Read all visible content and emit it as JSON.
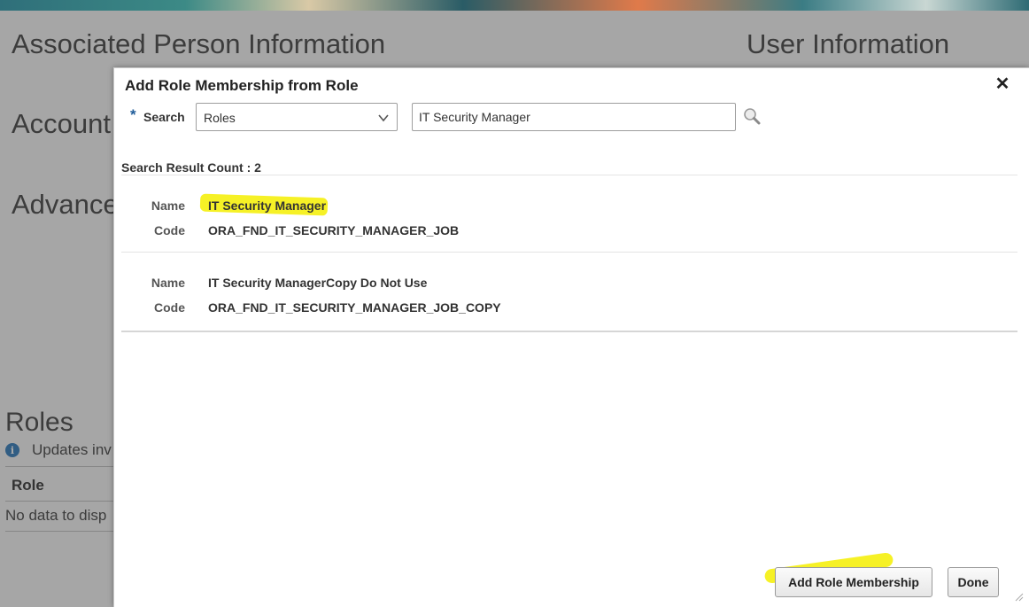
{
  "background": {
    "headings": {
      "associated_person": "Associated Person Information",
      "user_information": "User Information",
      "account": "Account",
      "advanced": "Advance"
    },
    "roles": {
      "title": "Roles",
      "info_text": "Updates inv",
      "column_header": "Role",
      "empty_text": "No data to disp"
    }
  },
  "dialog": {
    "title": "Add Role Membership from Role",
    "close_icon": "close-icon",
    "search": {
      "required_marker": "*",
      "label": "Search",
      "type_value": "Roles",
      "query_value": "IT Security Manager",
      "search_icon": "magnifier-icon"
    },
    "result_count_label": "Search Result Count : 2",
    "results": [
      {
        "name_label": "Name",
        "name": "IT Security Manager",
        "code_label": "Code",
        "code": "ORA_FND_IT_SECURITY_MANAGER_JOB"
      },
      {
        "name_label": "Name",
        "name": "IT Security ManagerCopy Do Not Use",
        "code_label": "Code",
        "code": "ORA_FND_IT_SECURITY_MANAGER_JOB_COPY"
      }
    ],
    "buttons": {
      "add_role_membership": "Add Role Membership",
      "done": "Done"
    }
  },
  "colors": {
    "highlight": "#f5ef00",
    "required_marker": "#1f5c99",
    "info_icon": "#1f6fb4"
  }
}
